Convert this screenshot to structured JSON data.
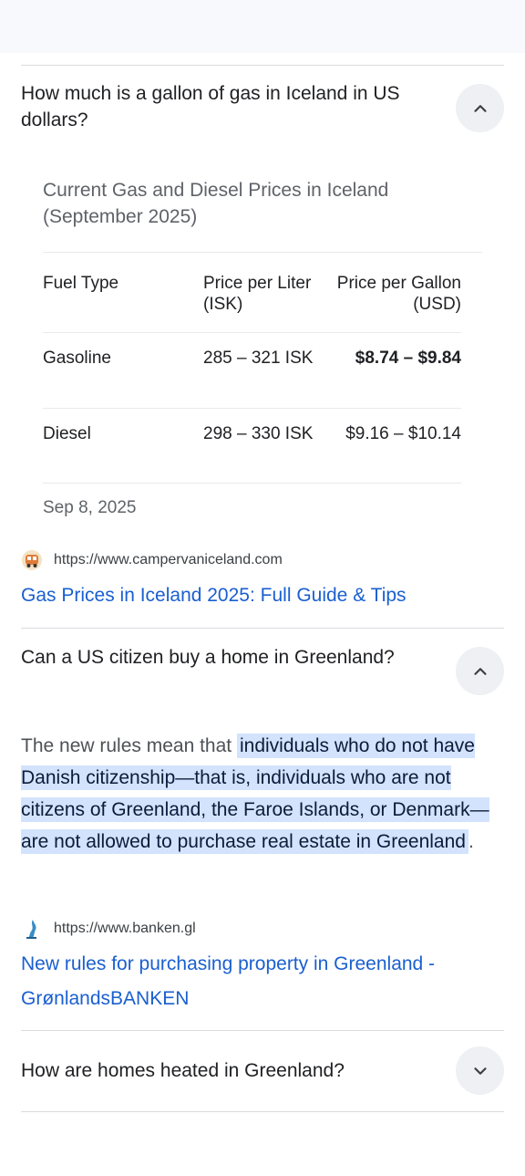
{
  "faq": [
    {
      "question": "How much is a gallon of gas in Iceland in US dollars?",
      "expanded": true,
      "answer_table": {
        "title": "Current Gas and Diesel Prices in Iceland (September 2025)",
        "headers": [
          "Fuel Type",
          "Price per Liter (ISK)",
          "Price per Gallon (USD)"
        ],
        "rows": [
          [
            "Gasoline",
            "285 – 321 ISK",
            "$8.74 – $9.84"
          ],
          [
            "Diesel",
            "298 – 330 ISK",
            "$9.16 – $10.14"
          ]
        ]
      },
      "date": "Sep 8, 2025",
      "source_url": "https://www.campervaniceland.com",
      "source_icon": "campervan-icon",
      "link_title": "Gas Prices in Iceland 2025: Full Guide & Tips"
    },
    {
      "question": "Can a US citizen buy a home in Greenland?",
      "expanded": true,
      "answer_prefix": "The new rules mean that ",
      "answer_highlight": "individuals who do not have Danish citizenship—that is, individuals who are not citizens of Greenland, the Faroe Islands, or Denmark—are not allowed to purchase real estate in Greenland",
      "answer_suffix": ".",
      "source_url": "https://www.banken.gl",
      "source_icon": "banken-logo-icon",
      "link_title": "New rules for purchasing property in Greenland - GrønlandsBANKEN"
    },
    {
      "question": "How are homes heated in Greenland?",
      "expanded": false
    }
  ],
  "colors": {
    "link": "#1a5fd0",
    "highlight": "#d3e3fd",
    "divider": "#dadce0",
    "chevron_bg": "#eef0f3"
  }
}
